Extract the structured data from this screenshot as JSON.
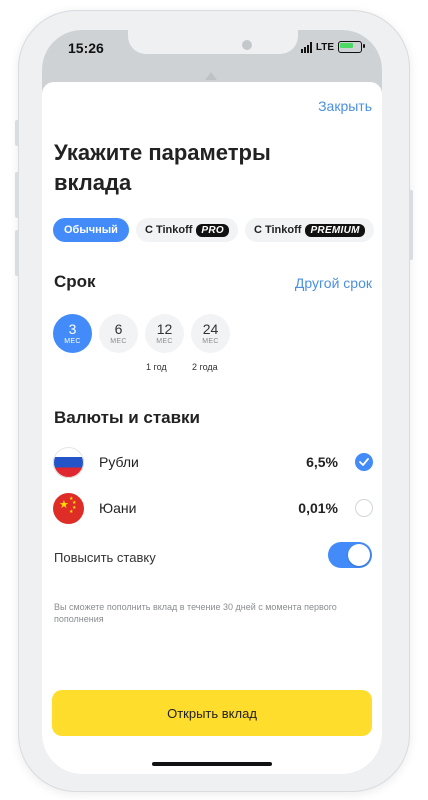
{
  "status_bar": {
    "time": "15:26",
    "network": "LTE"
  },
  "header": {
    "close_label": "Закрыть",
    "title": "Укажите параметры вклада"
  },
  "deposit_types": [
    {
      "label": "Обычный",
      "badge": "",
      "selected": true
    },
    {
      "label": "С Tinkoff",
      "badge": "PRO",
      "selected": false
    },
    {
      "label": "С Tinkoff",
      "badge": "PREMIUM",
      "selected": false
    }
  ],
  "term_section": {
    "title": "Срок",
    "other_label": "Другой срок",
    "options": [
      {
        "value": "3",
        "unit": "МЕС",
        "hint": "",
        "selected": true
      },
      {
        "value": "6",
        "unit": "МЕС",
        "hint": "",
        "selected": false
      },
      {
        "value": "12",
        "unit": "МЕС",
        "hint": "1 год",
        "selected": false
      },
      {
        "value": "24",
        "unit": "МЕС",
        "hint": "2 года",
        "selected": false
      }
    ]
  },
  "currency_section": {
    "title": "Валюты и ставки",
    "currencies": [
      {
        "name": "Рубли",
        "rate": "6,5%",
        "checked": true
      },
      {
        "name": "Юани",
        "rate": "0,01%",
        "checked": false
      }
    ]
  },
  "boost": {
    "label": "Повысить ставку",
    "enabled": true
  },
  "note": "Вы сможете пополнить вклад в течение 30 дней с момента первого пополнения",
  "open_button": "Открыть вклад",
  "colors": {
    "accent": "#428bf9",
    "link": "#4a90e2",
    "button": "#ffdd2d"
  }
}
